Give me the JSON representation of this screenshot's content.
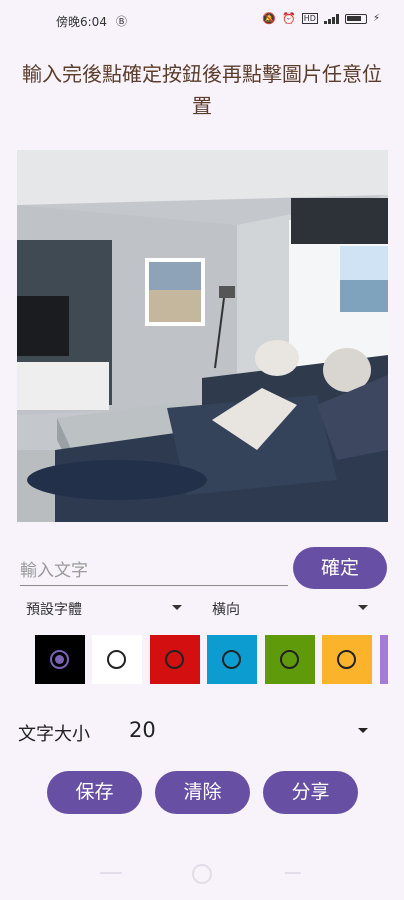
{
  "status_bar": {
    "time": "傍晚6:04",
    "left_icons": [
      "sim-icon"
    ],
    "right_icons": [
      "mute-icon",
      "alarm-icon",
      "hd-icon",
      "signal-icon",
      "battery-icon",
      "charging-icon"
    ]
  },
  "instruction": "輸入完後點確定按鈕後再點擊圖片任意位置",
  "text_input": {
    "placeholder": "輸入文字",
    "value": ""
  },
  "confirm_button": "確定",
  "font_dropdown": "預設字體",
  "orientation_dropdown": "橫向",
  "colors": [
    {
      "hex": "#000000",
      "selected": true
    },
    {
      "hex": "#ffffff",
      "selected": false
    },
    {
      "hex": "#d30f0f",
      "selected": false
    },
    {
      "hex": "#0c9cd0",
      "selected": false
    },
    {
      "hex": "#5f9a0b",
      "selected": false
    },
    {
      "hex": "#fbb32b",
      "selected": false
    },
    {
      "hex": "#a57bd8",
      "selected": false
    }
  ],
  "text_size": {
    "label": "文字大小",
    "value": "20"
  },
  "buttons": {
    "save": "保存",
    "clear": "清除",
    "share": "分享"
  },
  "accent": "#6750a4"
}
